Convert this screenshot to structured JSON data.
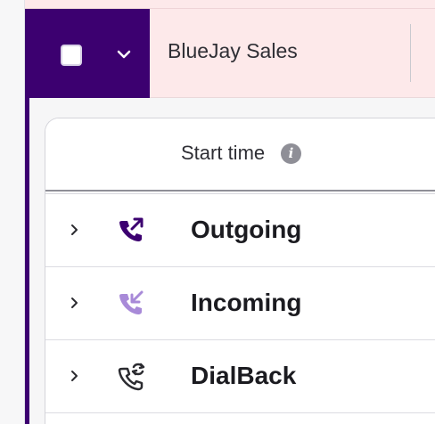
{
  "group": {
    "name": "BlueJay Sales",
    "accent_color": "#3c0070",
    "header_bg_color": "#fde9ea"
  },
  "table": {
    "columns": [
      {
        "label": "Start time",
        "info_icon": "info-icon"
      }
    ],
    "rows": [
      {
        "type_label": "Outgoing",
        "icon": "phone-outgoing-icon",
        "icon_color": "#3c0070"
      },
      {
        "type_label": "Incoming",
        "icon": "phone-incoming-icon",
        "icon_color": "#a88ad8"
      },
      {
        "type_label": "DialBack",
        "icon": "phone-dialback-icon",
        "icon_color": "#2b2b30"
      }
    ]
  },
  "icons": {
    "checkbox": "checkbox-icon",
    "group_expand": "chevron-down-icon",
    "row_expand": "chevron-right-icon",
    "info": "info-icon"
  }
}
